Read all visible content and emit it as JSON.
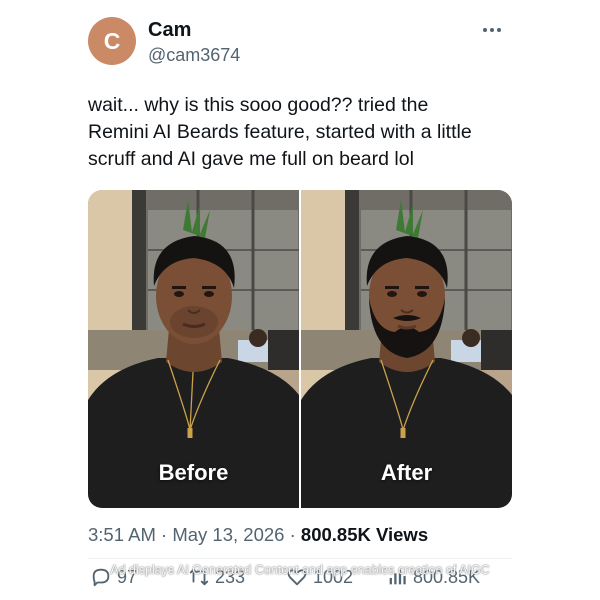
{
  "author": {
    "avatar_initial": "C",
    "name": "Cam",
    "handle": "@cam3674"
  },
  "tweet": {
    "lines": [
      "wait... why is this sooo good?? tried the",
      "Remini AI Beards feature, started with a little",
      "scruff and AI gave me full on beard lol"
    ]
  },
  "media": {
    "panels": [
      {
        "label": "Before"
      },
      {
        "label": "After"
      }
    ]
  },
  "meta": {
    "time": "3:51 AM",
    "sep": " · ",
    "date": "May 13, 2026",
    "views": "800.85K Views"
  },
  "notice": "Ad displays AI Generated Content and app enables creation of AIGC",
  "actions": {
    "replies": "97",
    "reposts": "233",
    "likes": "1002",
    "views": "800.85K"
  },
  "colors": {
    "avatar": "#c98a65",
    "text": "#0f1419",
    "secondary": "#536471"
  }
}
